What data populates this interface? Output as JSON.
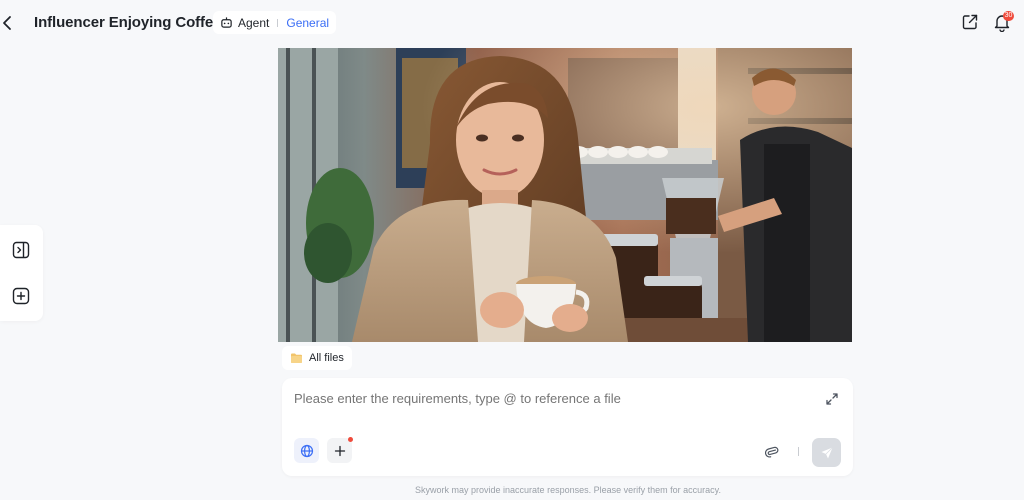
{
  "header": {
    "title": "Influencer Enjoying Coffee",
    "mode_agent": "Agent",
    "mode_general": "General",
    "notification_count": "30"
  },
  "files": {
    "label": "All files"
  },
  "composer": {
    "placeholder": "Please enter the requirements, type @ to reference a file"
  },
  "footer": {
    "disclaimer": "Skywork may provide inaccurate responses. Please verify them for accuracy."
  },
  "icons": {
    "back": "chevron-left-icon",
    "agent": "robot-icon",
    "share": "share-icon",
    "bell": "bell-icon",
    "sidebar_toggle": "sidebar-toggle-icon",
    "new_chat": "plus-square-icon",
    "folder": "folder-icon",
    "expand": "expand-icon",
    "globe": "globe-icon",
    "plus": "plus-icon",
    "attach": "attachment-icon",
    "send": "send-icon"
  },
  "colors": {
    "accent": "#3b6ef5",
    "badge": "#ef4b3c",
    "background": "#f7f8fa"
  }
}
